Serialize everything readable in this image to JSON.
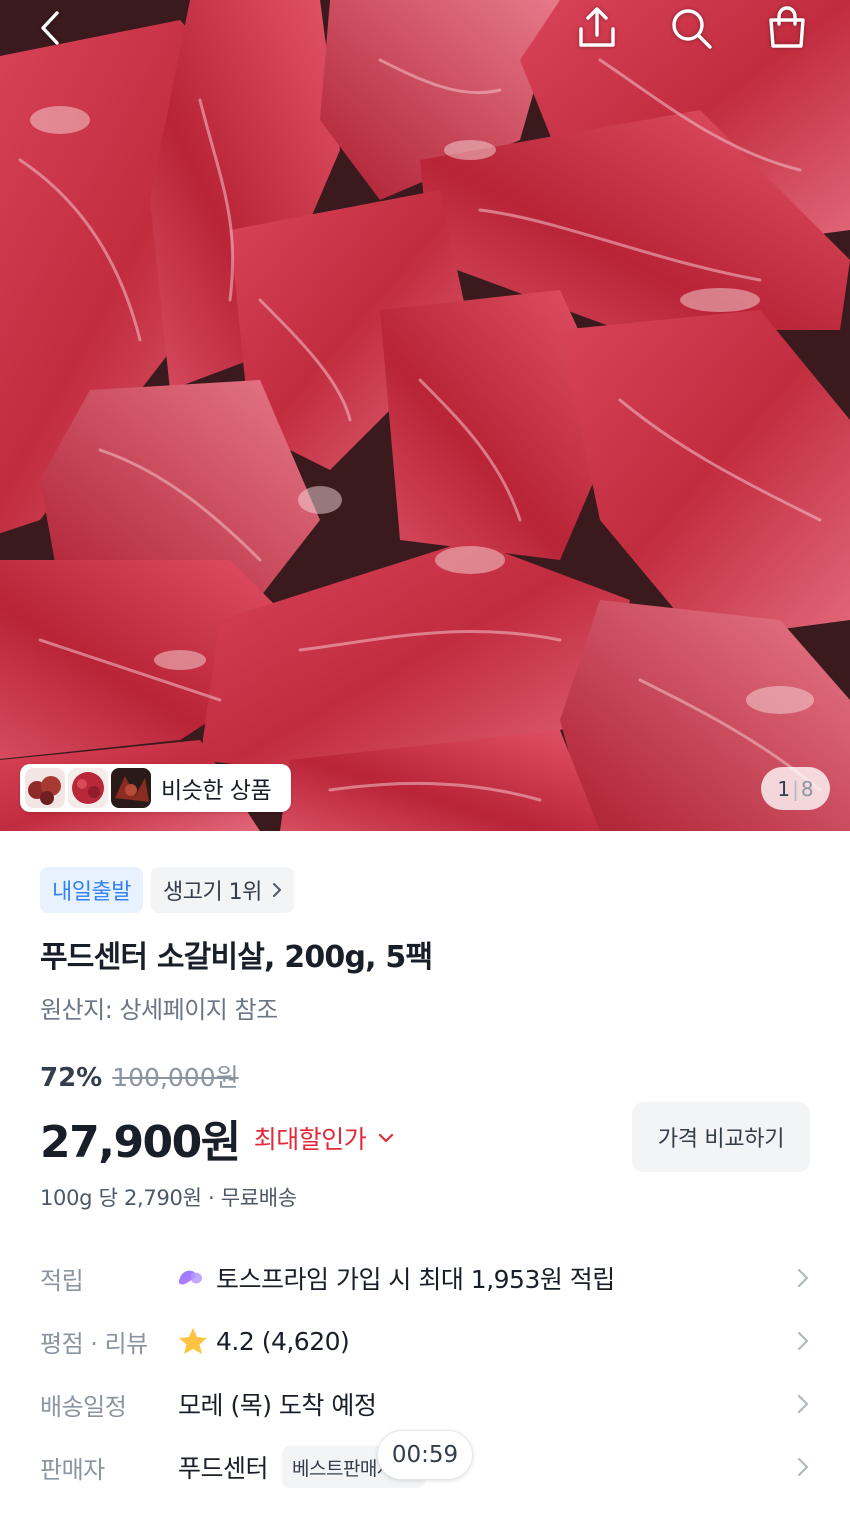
{
  "header": {
    "icons": [
      "back-arrow-icon",
      "share-icon",
      "search-icon",
      "shopping-bag-icon"
    ]
  },
  "gallery": {
    "similar_label": "비슷한 상품",
    "current": "1",
    "separator": "|",
    "total": "8"
  },
  "badges": {
    "delivery": "내일출발",
    "rank": "생고기 1위"
  },
  "product": {
    "title": "푸드센터 소갈비살, 200g, 5팩",
    "origin": "원산지: 상세페이지 참조"
  },
  "pricing": {
    "discount_rate": "72%",
    "original_price": "100,000원",
    "price": "27,900원",
    "max_discount_label": "최대할인가",
    "compare_button": "가격 비교하기",
    "unit_price": "100g 당 2,790원 · 무료배송"
  },
  "rows": {
    "reward": {
      "label": "적립",
      "value": "토스프라임 가입 시 최대 1,953원 적립"
    },
    "rating": {
      "label": "평점 · 리뷰",
      "value": "4.2 (4,620)"
    },
    "delivery": {
      "label": "배송일정",
      "value": "모레 (목) 도착 예정"
    },
    "seller": {
      "label": "판매자",
      "value": "푸드센터",
      "tag": "베스트판매자"
    }
  },
  "timer": "00:59",
  "colors": {
    "accent_blue": "#3182f6",
    "discount_red": "#e42939",
    "star_yellow": "#ffc342"
  }
}
